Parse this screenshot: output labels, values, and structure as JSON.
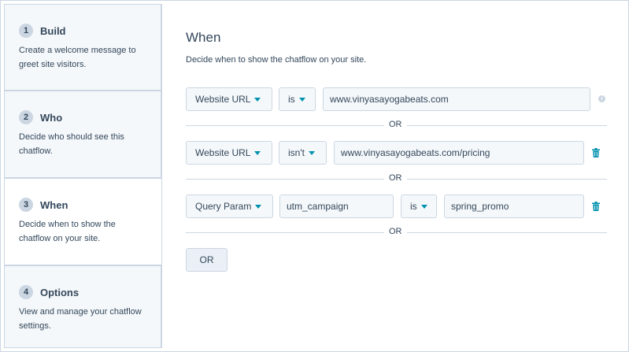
{
  "steps": [
    {
      "num": "1",
      "title": "Build",
      "desc": "Create a welcome message to greet site visitors."
    },
    {
      "num": "2",
      "title": "Who",
      "desc": "Decide who should see this chatflow."
    },
    {
      "num": "3",
      "title": "When",
      "desc": "Decide when to show the chatflow on your site."
    },
    {
      "num": "4",
      "title": "Options",
      "desc": "View and manage your chatflow settings."
    }
  ],
  "main": {
    "title": "When",
    "subtitle": "Decide when to show the chatflow on your site."
  },
  "rules": [
    {
      "property": "Website URL",
      "operator": "is",
      "value": "www.vinyasayogabeats.com"
    },
    {
      "property": "Website URL",
      "operator": "isn't",
      "value": "www.vinyasayogabeats.com/pricing"
    },
    {
      "property": "Query Param",
      "param": "utm_campaign",
      "operator": "is",
      "value": "spring_promo"
    }
  ],
  "or_label": "OR",
  "or_button": "OR",
  "colors": {
    "accent": "#0091ae",
    "border": "#cbd6e2",
    "text": "#33475b",
    "panel": "#f5f8fa"
  },
  "icons": {
    "info": "info-icon",
    "delete": "trash-icon",
    "dropdown": "caret-down-icon"
  }
}
